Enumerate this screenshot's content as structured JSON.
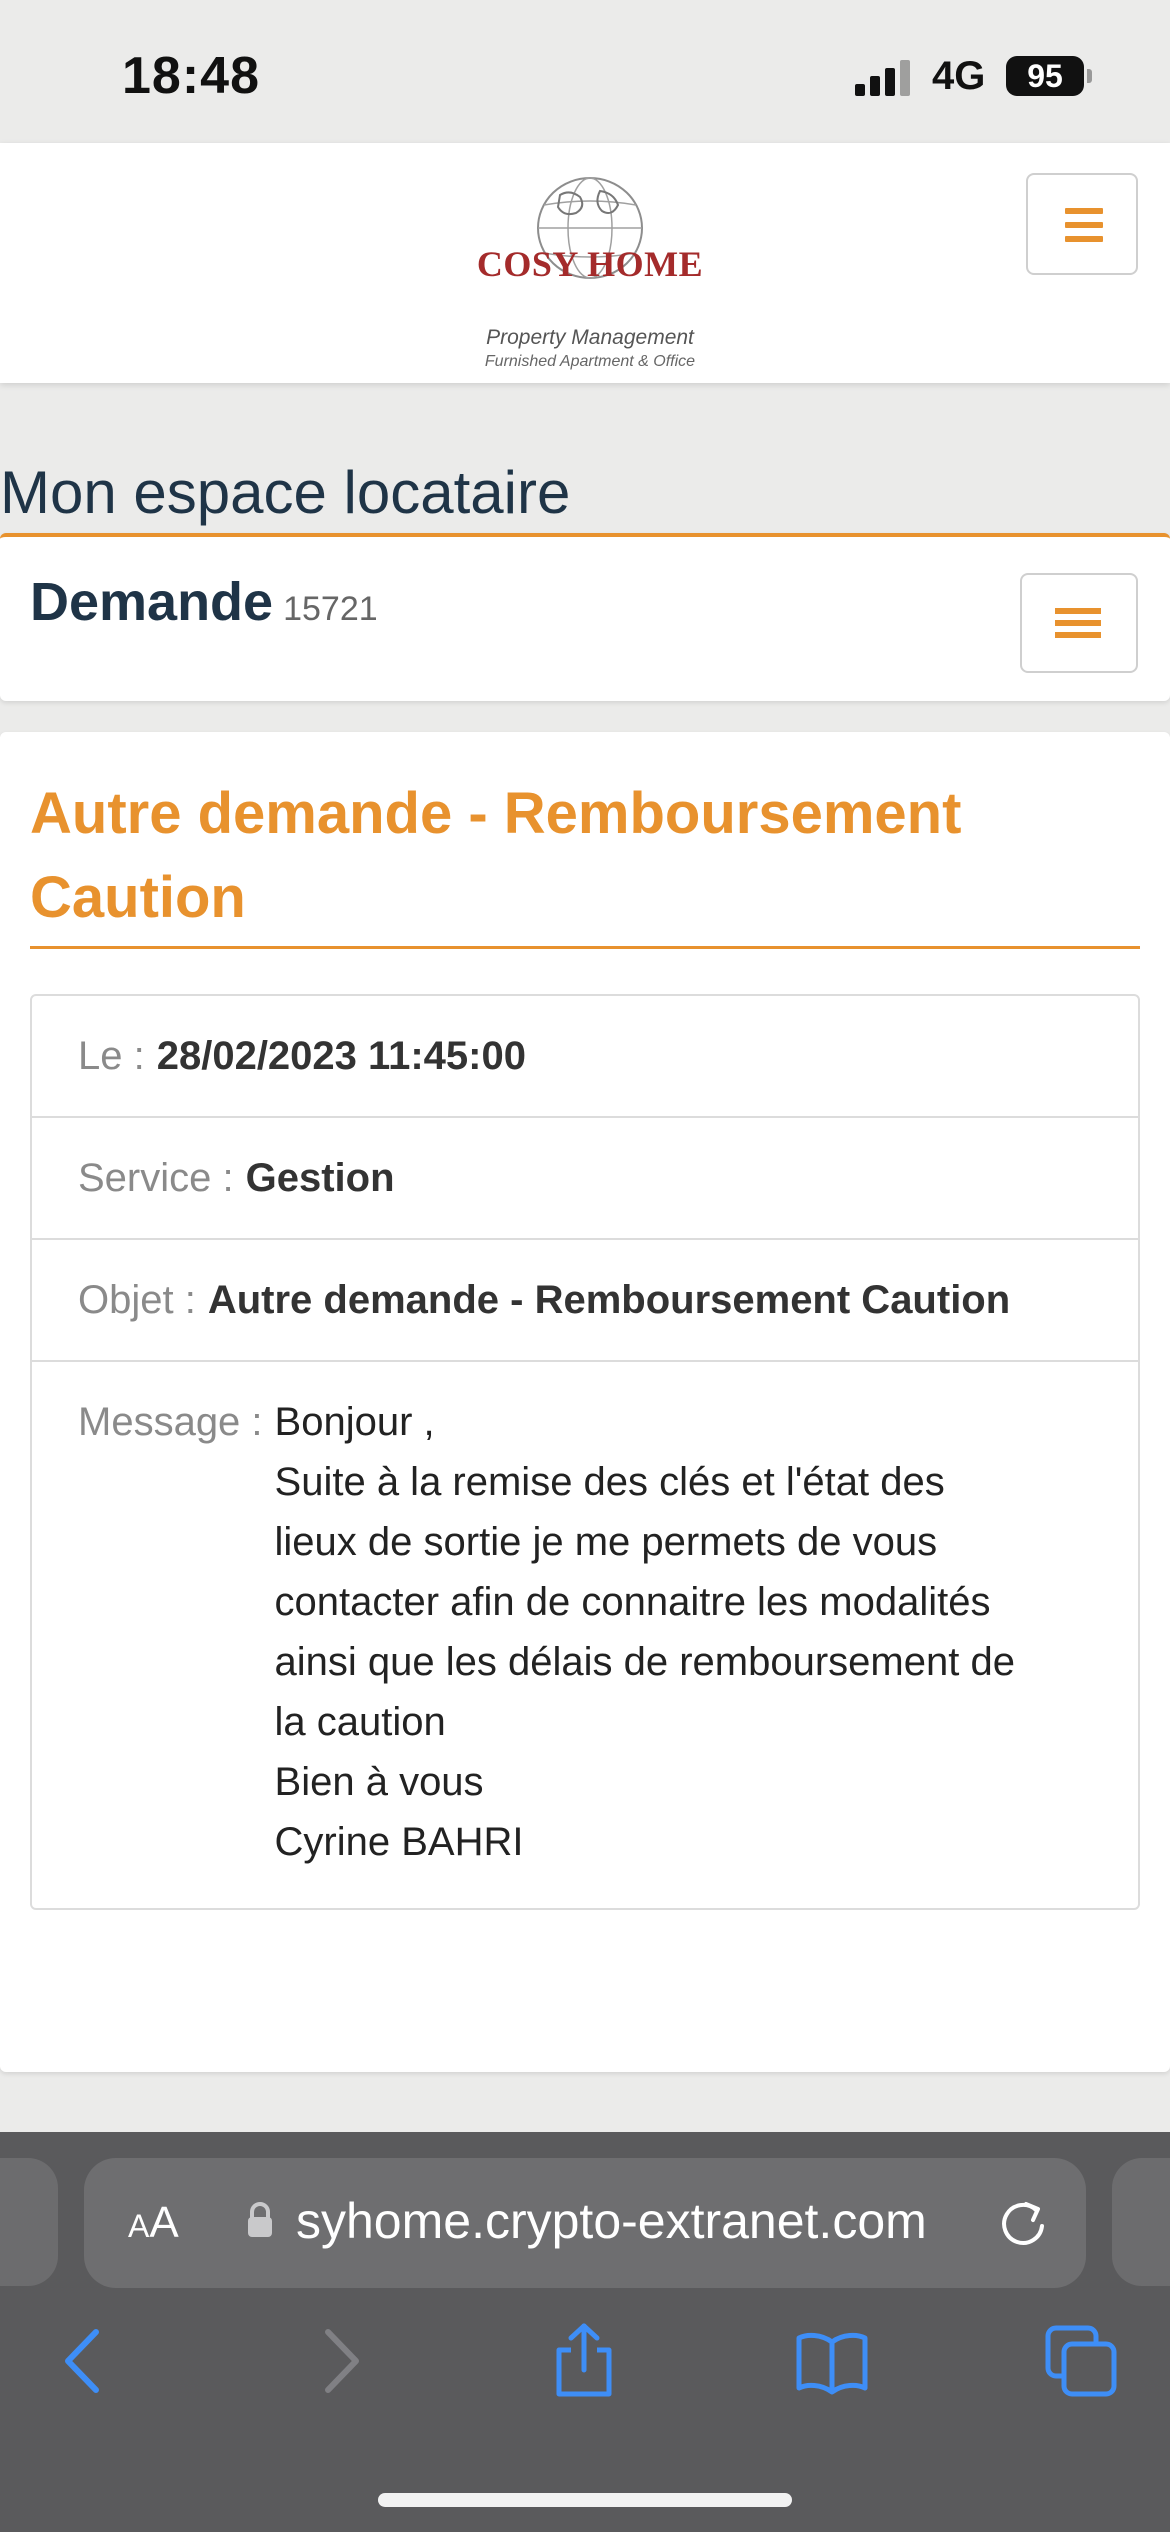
{
  "status_bar": {
    "time": "18:48",
    "network": "4G",
    "battery": "95"
  },
  "header": {
    "logo": {
      "brand": "COSY HOME",
      "tagline": "Property Management",
      "subtagline": "Furnished Apartment & Office"
    },
    "menu_icon": "hamburger-icon"
  },
  "page": {
    "title": "Mon espace locataire"
  },
  "demande": {
    "label": "Demande",
    "number": "15721",
    "list_icon": "list-icon"
  },
  "request": {
    "title": "Autre demande - Remboursement Caution",
    "details": [
      {
        "label": "Le :",
        "value": "28/02/2023 11:45:00"
      },
      {
        "label": "Service :",
        "value": "Gestion"
      },
      {
        "label": "Objet :",
        "value": "Autre demande - Remboursement Caution"
      }
    ],
    "message_label": "Message :",
    "message_lines": [
      "Bonjour ,",
      "Suite à la remise des clés et l'état des",
      "lieux de sortie je me permets de vous",
      "contacter afin de connaitre les modalités",
      "ainsi que les délais de remboursement de",
      "la caution",
      "Bien à vous",
      "Cyrine BAHRI"
    ]
  },
  "browser": {
    "text_size_label": "AA",
    "url": "syhome.crypto-extranet.com",
    "accent": "#3e8ef7"
  },
  "colors": {
    "accent_orange": "#e8922e",
    "title_navy": "#1f3447",
    "logo_red": "#a42b2b"
  }
}
